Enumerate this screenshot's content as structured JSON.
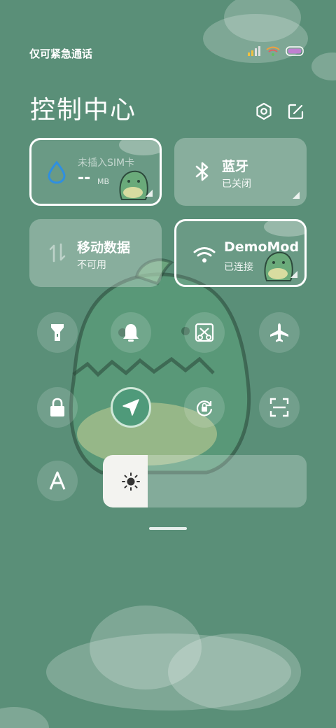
{
  "status": {
    "carrier_text": "仅可紧急通话"
  },
  "header": {
    "title": "控制中心"
  },
  "tiles": {
    "data_usage": {
      "line1": "未插入SIM卡",
      "value": "--",
      "unit": "MB"
    },
    "bluetooth": {
      "label": "蓝牙",
      "status": "已关闭"
    },
    "mobile_data": {
      "label": "移动数据",
      "status": "不可用"
    },
    "wifi": {
      "label": "DemoMod",
      "status": "已连接"
    }
  },
  "toggles": [
    {
      "name": "flashlight",
      "icon": "flashlight-icon",
      "active": false
    },
    {
      "name": "bell",
      "icon": "bell-icon",
      "active": false
    },
    {
      "name": "screenshot",
      "icon": "scissors-icon",
      "active": false
    },
    {
      "name": "airplane",
      "icon": "airplane-icon",
      "active": false
    },
    {
      "name": "lock",
      "icon": "lock-icon",
      "active": false
    },
    {
      "name": "location",
      "icon": "location-arrow-icon",
      "active": true
    },
    {
      "name": "rotation-lock",
      "icon": "rotation-lock-icon",
      "active": false
    },
    {
      "name": "scan",
      "icon": "scan-icon",
      "active": false
    },
    {
      "name": "font",
      "icon": "font-a-icon",
      "active": false
    }
  ],
  "brightness": {
    "level": 0.22
  },
  "colors": {
    "background": "#5a8f78",
    "accent_blue": "#2f8fe0",
    "active_button": "#4f9a7a"
  }
}
